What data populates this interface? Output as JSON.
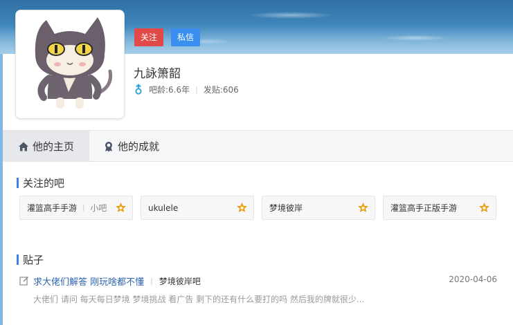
{
  "profile": {
    "follow_label": "关注",
    "message_label": "私信",
    "username": "九詠箫韶",
    "gender_icon": "male-icon",
    "age_label": "吧龄:6.6年",
    "posts_label": "发贴:606",
    "meta_separator": "|"
  },
  "tabs": [
    {
      "label": "他的主页",
      "icon": "home-icon",
      "active": true
    },
    {
      "label": "他的成就",
      "icon": "medal-icon",
      "active": false
    }
  ],
  "followed_section": {
    "title": "关注的吧",
    "forums": [
      {
        "name": "灌篮高手手游",
        "alias": "小吧",
        "separator": "|"
      },
      {
        "name": "ukulele"
      },
      {
        "name": "梦境彼岸"
      },
      {
        "name": "灌篮高手正版手游"
      }
    ]
  },
  "posts_section": {
    "title": "贴子",
    "posts": [
      {
        "title": "求大佬们解答 刚玩啥都不懂",
        "separator": "|",
        "forum": "梦境彼岸吧",
        "date": "2020-04-06",
        "excerpt": "大佬们 请问 每天每日梦境 梦境挑战 看广告 剩下的还有什么要打的吗 然后我的牌就很少..."
      }
    ]
  },
  "colors": {
    "follow_button": "#e24a49",
    "message_button": "#3a8ff0",
    "accent_bar": "#3a7ee8",
    "post_link": "#2d64b3",
    "level_badge": "#f0a415"
  }
}
